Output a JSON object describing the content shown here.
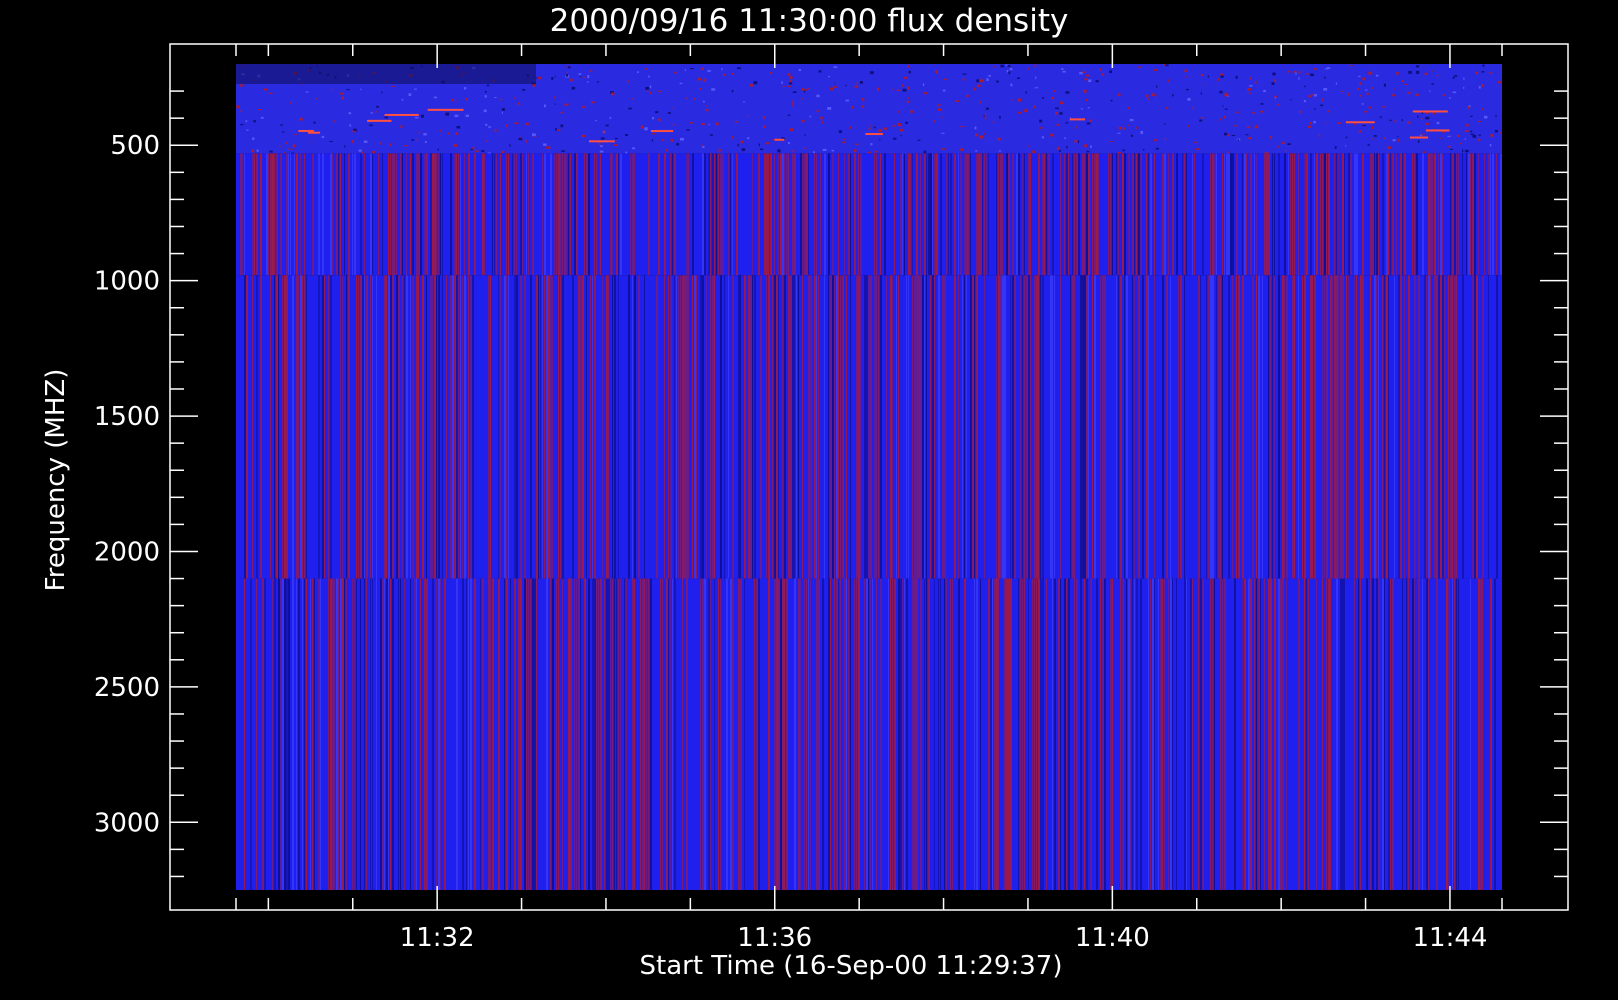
{
  "chart_data": {
    "type": "heatmap",
    "title": "2000/09/16 11:30:00 flux density",
    "xlabel": "Start Time (16-Sep-00 11:29:37)",
    "ylabel": "Frequency (MHZ)",
    "x_axis": {
      "unit": "time",
      "data_start": "11:29:37",
      "data_end": "11:44:37",
      "tick_labels": [
        "11:32",
        "11:36",
        "11:40",
        "11:44"
      ]
    },
    "y_axis": {
      "unit": "MHz",
      "inverted": true,
      "data_range": [
        200,
        3250
      ],
      "tick_values": [
        500,
        1000,
        1500,
        2000,
        2500,
        3000
      ]
    },
    "frequency_bands": [
      {
        "from": 200,
        "to": 530,
        "appearance": "noisy, blue with scattered red bursts"
      },
      {
        "from": 530,
        "to": 980,
        "appearance": "blue with dense red vertical striping"
      },
      {
        "from": 980,
        "to": 2100,
        "appearance": "blue with red vertical striping"
      },
      {
        "from": 2100,
        "to": 3250,
        "appearance": "blue with red vertical striping"
      }
    ],
    "colors": {
      "background": "#000000",
      "base": "#2020ee",
      "high": "#c01818",
      "axes": "#ffffff"
    }
  }
}
